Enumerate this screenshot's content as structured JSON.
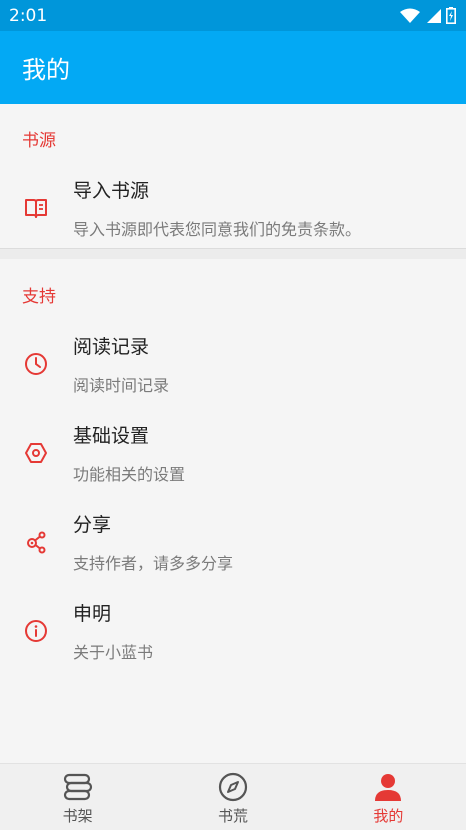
{
  "status": {
    "time": "2:01"
  },
  "appbar": {
    "title": "我的"
  },
  "sections": [
    {
      "title": "书源",
      "items": [
        {
          "title": "导入书源",
          "subtitle": "导入书源即代表您同意我们的免责条款。",
          "icon": "book-icon"
        }
      ]
    },
    {
      "title": "支持",
      "items": [
        {
          "title": "阅读记录",
          "subtitle": "阅读时间记录",
          "icon": "clock-icon"
        },
        {
          "title": "基础设置",
          "subtitle": "功能相关的设置",
          "icon": "settings-hexagon-icon"
        },
        {
          "title": "分享",
          "subtitle": "支持作者，请多多分享",
          "icon": "share-icon"
        },
        {
          "title": "申明",
          "subtitle": "关于小蓝书",
          "icon": "info-icon"
        }
      ]
    }
  ],
  "bottom_nav": [
    {
      "label": "书架",
      "icon": "bookshelf-icon",
      "active": false
    },
    {
      "label": "书荒",
      "icon": "compass-icon",
      "active": false
    },
    {
      "label": "我的",
      "icon": "person-icon",
      "active": true
    }
  ],
  "colors": {
    "primary": "#03a9f4",
    "status_bar": "#0096da",
    "accent": "#e53935"
  }
}
